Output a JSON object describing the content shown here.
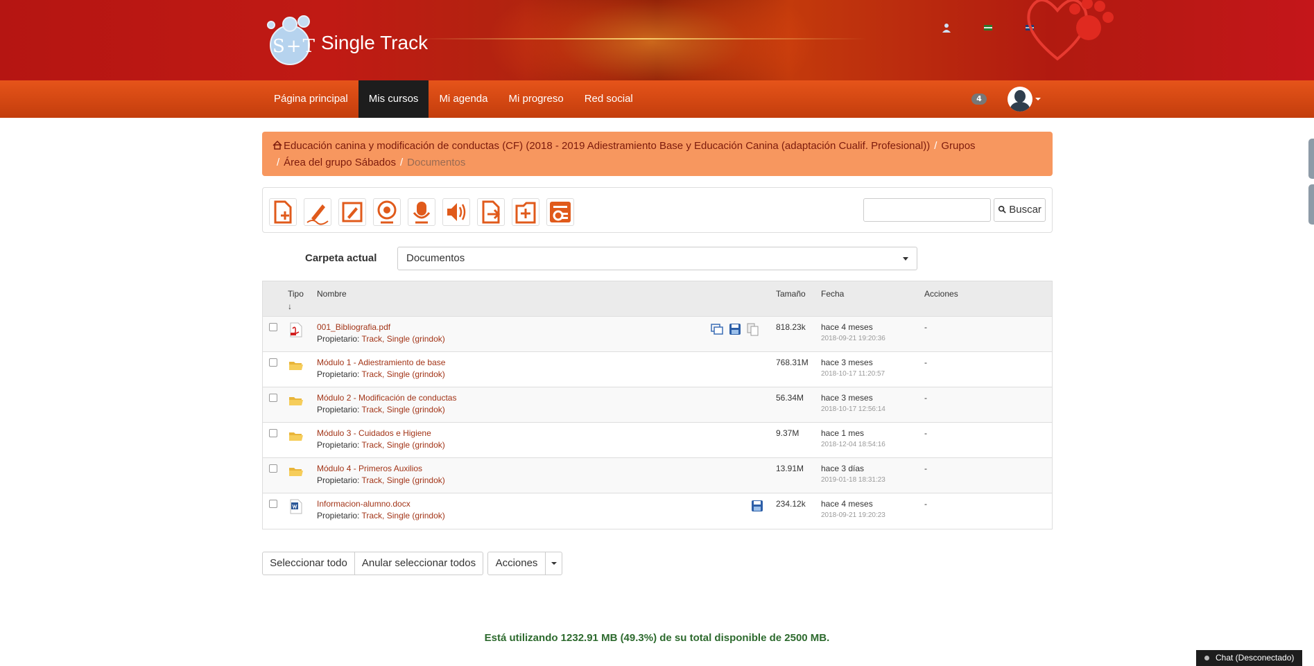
{
  "header": {
    "logo_mark": "S+T",
    "logo_text": "Single Track"
  },
  "navbar": {
    "items": [
      {
        "label": "Página principal",
        "active": false
      },
      {
        "label": "Mis cursos",
        "active": true
      },
      {
        "label": "Mi agenda",
        "active": false
      },
      {
        "label": "Mi progreso",
        "active": false
      },
      {
        "label": "Red social",
        "active": false
      }
    ],
    "notifications_count": "4"
  },
  "breadcrumb": {
    "course": "Educación canina y modificación de conductas (CF) (2018 - 2019 Adiestramiento Base y Educación Canina (adaptación Cualif. Profesional))",
    "groups": "Grupos",
    "group_area": "Área del grupo Sábados",
    "current": "Documentos"
  },
  "toolbar": {
    "tools": [
      "new-document-icon",
      "draw-icon",
      "edit-template-icon",
      "webcam-icon",
      "record-audio-icon",
      "audio-icon",
      "upload-icon",
      "new-folder-icon",
      "slideshow-icon"
    ],
    "search_placeholder": "",
    "search_label": "Buscar"
  },
  "folder": {
    "label": "Carpeta actual",
    "selected": "Documentos"
  },
  "table": {
    "headers": {
      "type": "Tipo",
      "sort_arrow": "↓",
      "name": "Nombre",
      "size": "Tamaño",
      "date": "Fecha",
      "actions": "Acciones"
    },
    "owner_label": "Propietario:",
    "rows": [
      {
        "type": "pdf",
        "name": "001_Bibliografia.pdf",
        "owner": "Track, Single (grindok)",
        "size": "818.23k",
        "date_rel": "hace 4 meses",
        "date_abs": "2018-09-21 19:20:36",
        "actions": "-"
      },
      {
        "type": "folder",
        "name": "Módulo 1 - Adiestramiento de base",
        "owner": "Track, Single (grindok)",
        "size": "768.31M",
        "date_rel": "hace 3 meses",
        "date_abs": "2018-10-17 11:20:57",
        "actions": "-"
      },
      {
        "type": "folder",
        "name": "Módulo 2 - Modificación de conductas",
        "owner": "Track, Single (grindok)",
        "size": "56.34M",
        "date_rel": "hace 3 meses",
        "date_abs": "2018-10-17 12:56:14",
        "actions": "-"
      },
      {
        "type": "folder",
        "name": "Módulo 3 - Cuidados e Higiene",
        "owner": "Track, Single (grindok)",
        "size": "9.37M",
        "date_rel": "hace 1 mes",
        "date_abs": "2018-12-04 18:54:16",
        "actions": "-"
      },
      {
        "type": "folder",
        "name": "Módulo 4 - Primeros Auxilios",
        "owner": "Track, Single (grindok)",
        "size": "13.91M",
        "date_rel": "hace 3 días",
        "date_abs": "2019-01-18 18:31:23",
        "actions": "-"
      },
      {
        "type": "docx",
        "name": "Informacion-alumno.docx",
        "owner": "Track, Single (grindok)",
        "size": "234.12k",
        "date_rel": "hace 4 meses",
        "date_abs": "2018-09-21 19:20:23",
        "actions": "-"
      }
    ]
  },
  "bottom": {
    "select_all": "Seleccionar todo",
    "unselect_all": "Anular seleccionar todos",
    "actions": "Acciones"
  },
  "quota": "Está utilizando 1232.91 MB (49.3%) de su total disponible de 2500 MB.",
  "chat": "Chat (Desconectado)",
  "colors": {
    "banner_red": "#c01a14",
    "navbar_orange": "#e6541a",
    "nav_active": "#1d1d1d",
    "breadcrumb_bg": "#f7975f",
    "link": "#a23417",
    "quota_green": "#2d6a2e"
  }
}
